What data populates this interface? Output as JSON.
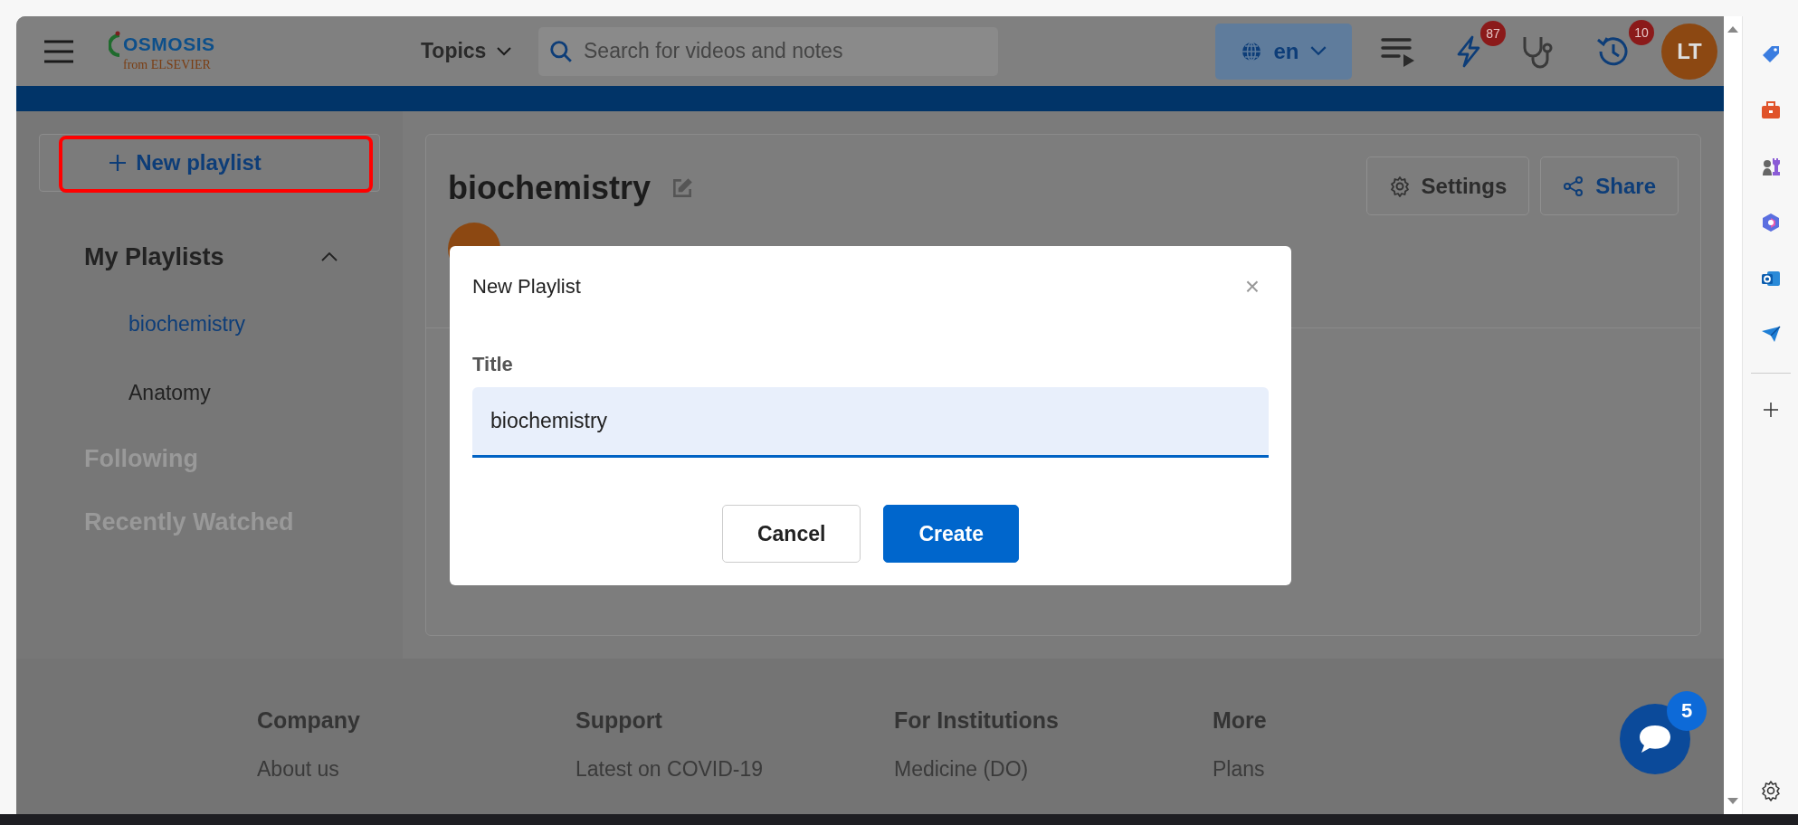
{
  "header": {
    "logo": {
      "name": "OSMOSIS",
      "tagline": "from ELSEVIER"
    },
    "topics": "Topics",
    "search": {
      "placeholder": "Search for videos and notes"
    },
    "language": "en",
    "icons": [
      {
        "kind": "queue"
      },
      {
        "kind": "bolt",
        "badge": "87"
      },
      {
        "kind": "stethoscope"
      },
      {
        "kind": "history",
        "badge": "10"
      }
    ],
    "avatar": "LT"
  },
  "sidebar": {
    "new_playlist": {
      "label": "New playlist",
      "highlighted": true
    },
    "sections": [
      {
        "label": "My Playlists",
        "active": true,
        "expanded": true,
        "children": [
          {
            "label": "biochemistry",
            "selected": true
          },
          {
            "label": "Anatomy",
            "selected": false
          }
        ]
      },
      {
        "label": "Following",
        "active": false
      },
      {
        "label": "Recently Watched",
        "active": false
      }
    ]
  },
  "playlist": {
    "title": "biochemistry",
    "buttons": [
      {
        "kind": "settings",
        "label": "Settings"
      },
      {
        "kind": "share",
        "label": "Share"
      }
    ]
  },
  "dialog": {
    "title": "New Playlist",
    "close": "×",
    "field_label": "Title",
    "value": "biochemistry",
    "buttons": [
      {
        "label": "Cancel",
        "primary": false
      },
      {
        "label": "Create",
        "primary": true
      }
    ]
  },
  "footer": {
    "columns": [
      {
        "heading": "Company",
        "links": [
          "About us"
        ]
      },
      {
        "heading": "Support",
        "links": [
          "Latest on COVID-19"
        ]
      },
      {
        "heading": "For Institutions",
        "links": [
          "Medicine (DO)"
        ]
      },
      {
        "heading": "More",
        "links": [
          "Plans"
        ]
      }
    ]
  },
  "chat": {
    "badge": "5"
  }
}
